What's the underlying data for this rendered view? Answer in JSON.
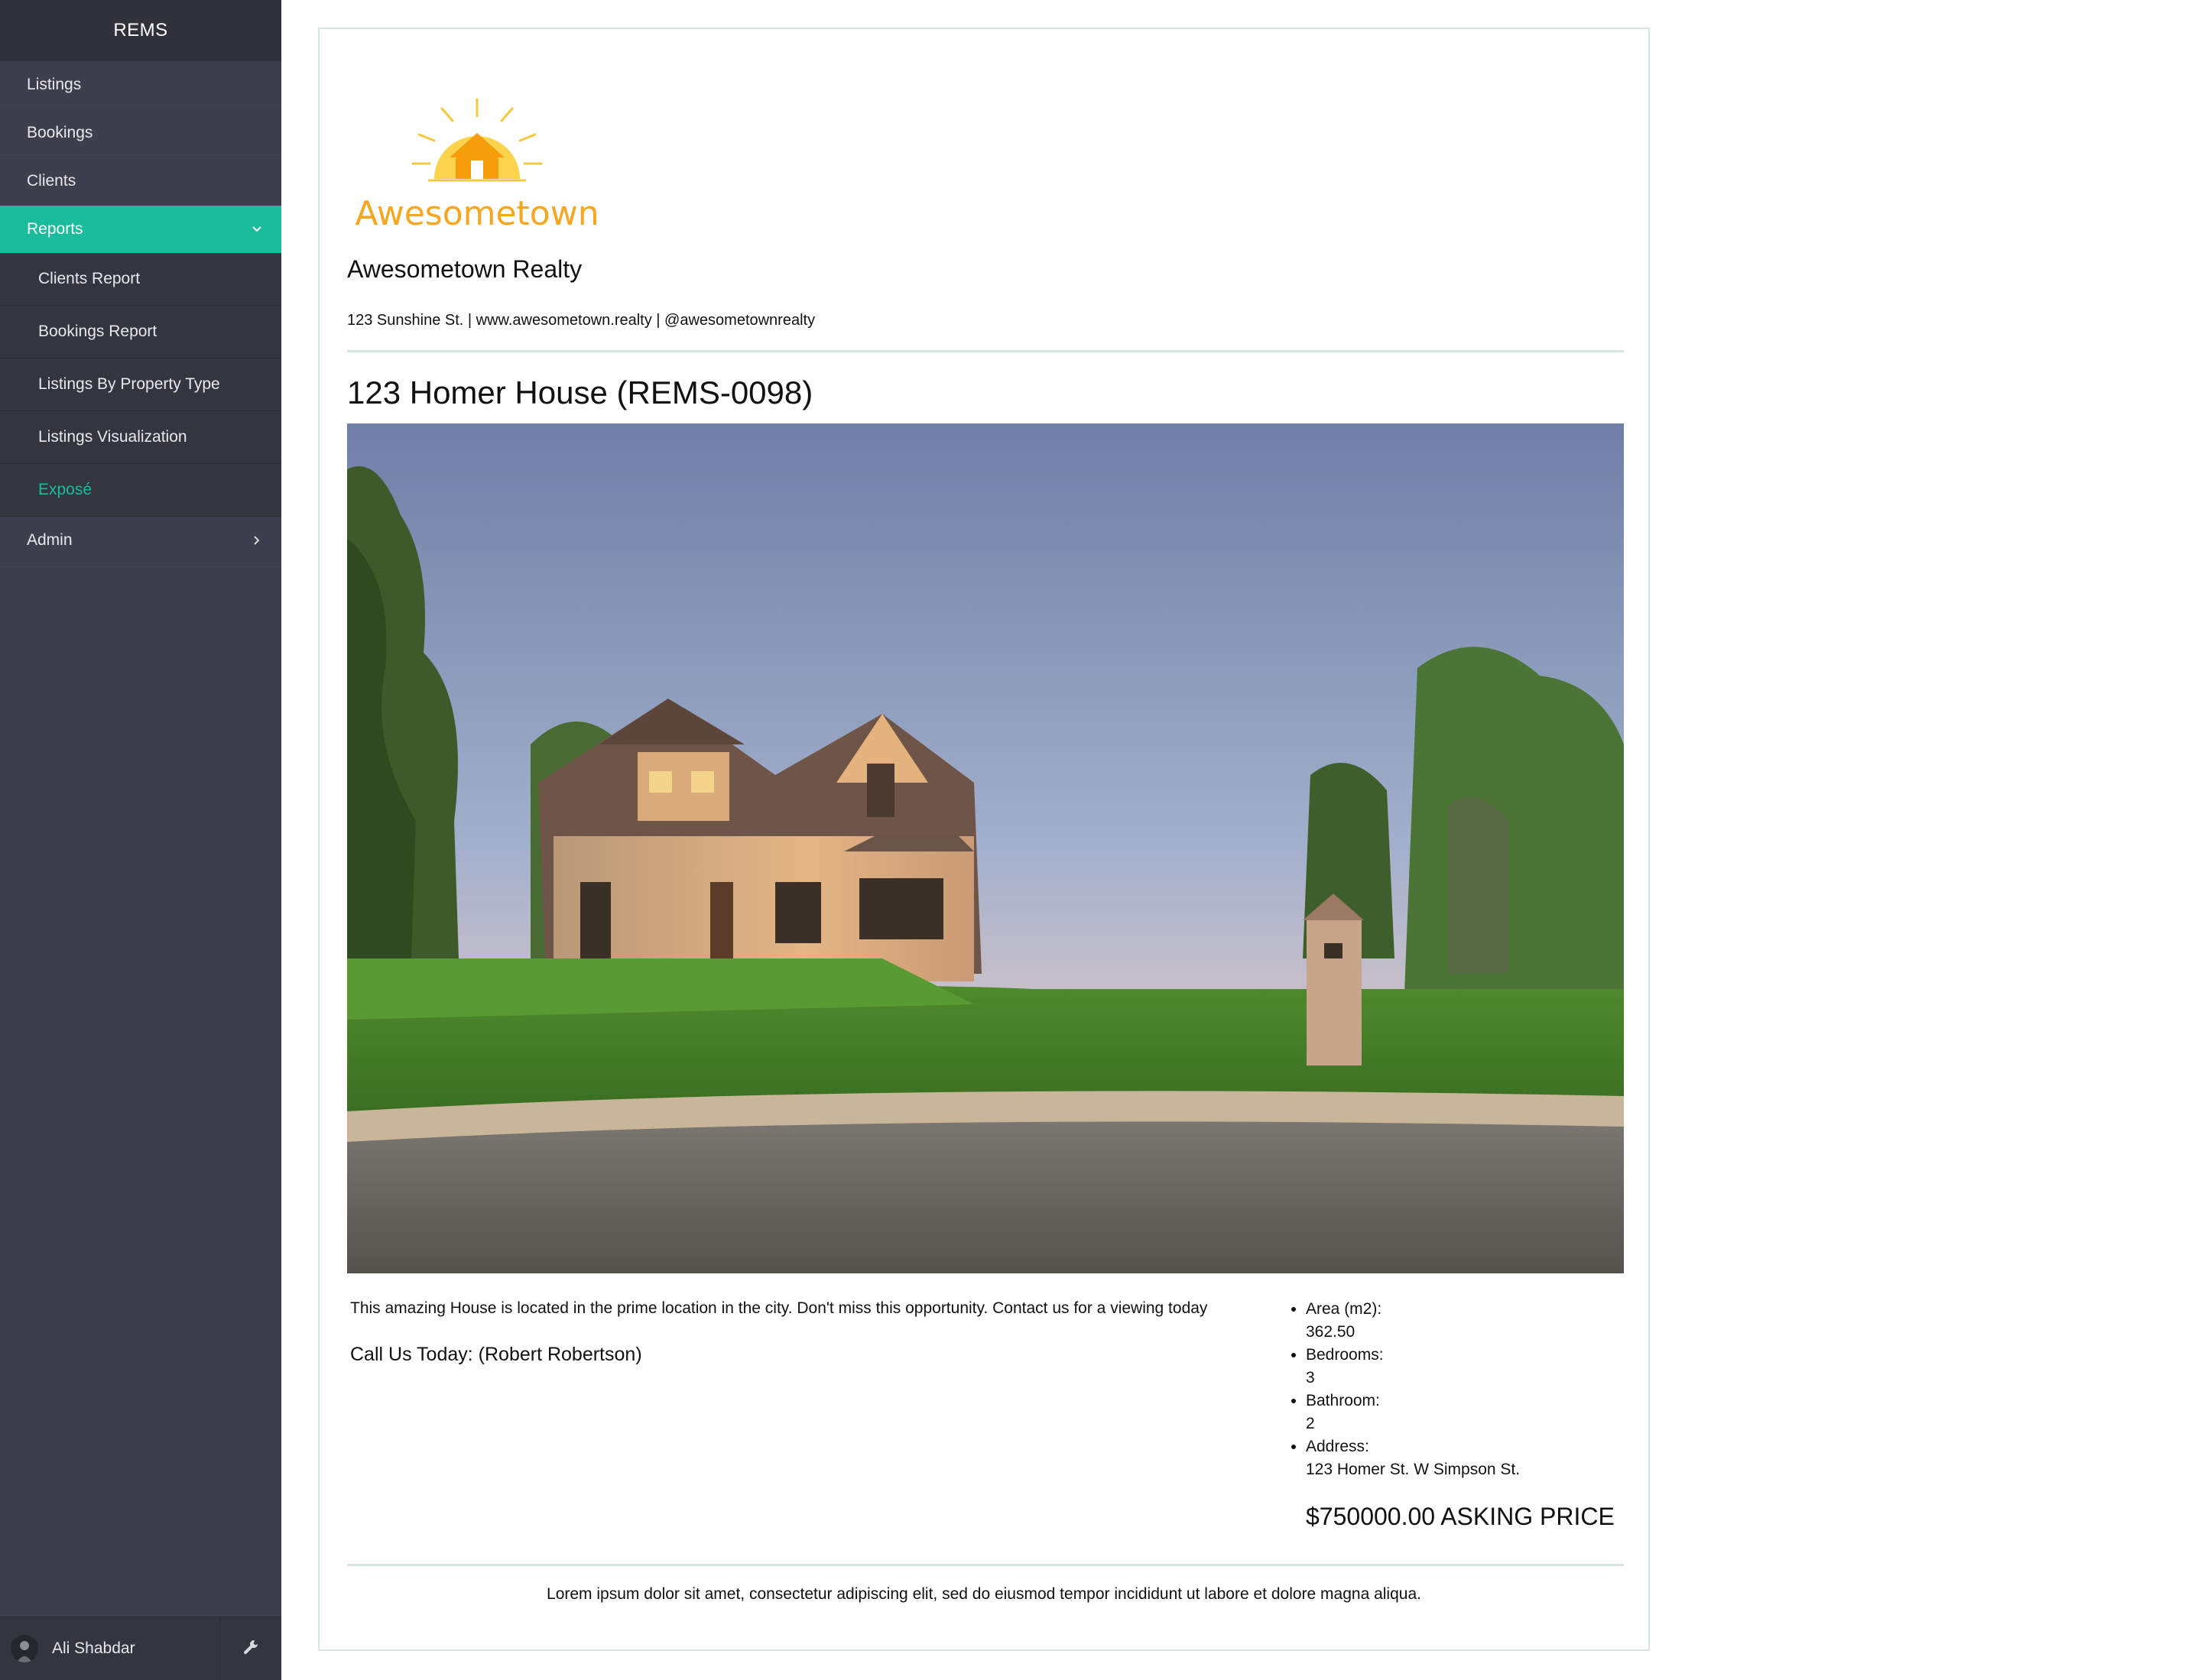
{
  "app": {
    "brand": "REMS"
  },
  "sidebar": {
    "items": [
      {
        "label": "Listings"
      },
      {
        "label": "Bookings"
      },
      {
        "label": "Clients"
      },
      {
        "label": "Reports"
      },
      {
        "label": "Admin"
      }
    ],
    "reports_submenu": [
      {
        "label": "Clients Report"
      },
      {
        "label": "Bookings Report"
      },
      {
        "label": "Listings By Property Type"
      },
      {
        "label": "Listings Visualization"
      },
      {
        "label": "Exposé"
      }
    ],
    "user": {
      "name": "Ali Shabdar"
    },
    "accent_color": "#1abc9c",
    "icons": {
      "reports_chevron": "chevron-down-icon",
      "admin_chevron": "chevron-right-icon",
      "settings": "wrench-icon"
    }
  },
  "expose": {
    "logo_text": "Awesometown",
    "company_name": "Awesometown Realty",
    "contact_line": "123 Sunshine St. | www.awesometown.realty | @awesometownrealty",
    "listing_title": "123 Homer House (REMS-0098)",
    "description": "This amazing House is located in the prime location in the city. Don't miss this opportunity. Contact us for a viewing today",
    "call_us": "Call Us Today: (Robert Robertson)",
    "details": [
      {
        "label": "Area (m2):",
        "value": "362.50"
      },
      {
        "label": "Bedrooms:",
        "value": "3"
      },
      {
        "label": "Bathroom:",
        "value": "2"
      },
      {
        "label": "Address:",
        "value": "123 Homer St. W Simpson St."
      }
    ],
    "price": "$750000.00 ASKING PRICE",
    "footer": "Lorem ipsum dolor sit amet, consectetur adipiscing elit, sed do eiusmod tempor incididunt ut labore et dolore magna aliqua."
  }
}
